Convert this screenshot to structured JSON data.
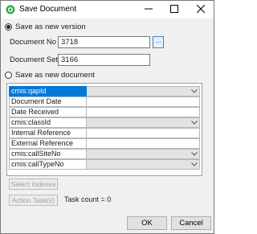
{
  "window": {
    "title": "Save Document",
    "icon": "green-circle-app-icon"
  },
  "save_as_new_version": {
    "label": "Save as new version",
    "selected": true,
    "document_no_label": "Document No",
    "document_no_value": "3718",
    "browse_label": "...",
    "document_set_label": "Document Set",
    "document_set_value": "3166"
  },
  "save_as_new_document": {
    "label": "Save as new document",
    "selected": false
  },
  "properties": [
    {
      "label": "cmis:qapId",
      "editor": "combo",
      "selected": true,
      "value": ""
    },
    {
      "label": "Document Date",
      "editor": "text",
      "selected": false,
      "value": ""
    },
    {
      "label": "Date Received",
      "editor": "text",
      "selected": false,
      "value": ""
    },
    {
      "label": "cmis:classId",
      "editor": "combo",
      "selected": false,
      "value": ""
    },
    {
      "label": "Internal Reference",
      "editor": "text",
      "selected": false,
      "value": ""
    },
    {
      "label": "External Reference",
      "editor": "text",
      "selected": false,
      "value": ""
    },
    {
      "label": "cmis:callSiteNo",
      "editor": "combo",
      "selected": false,
      "value": ""
    },
    {
      "label": "cmis:callTypeNo",
      "editor": "combo",
      "selected": false,
      "value": ""
    }
  ],
  "actions": {
    "select_indexes": "Select Indexes",
    "action_tasks": "Action Task(s)",
    "task_count": "Task count = 0"
  },
  "footer": {
    "ok": "OK",
    "cancel": "Cancel"
  },
  "colors": {
    "selection": "#0078d7",
    "icon_green": "#3aa84a",
    "browse_border": "#3c7fd6"
  }
}
